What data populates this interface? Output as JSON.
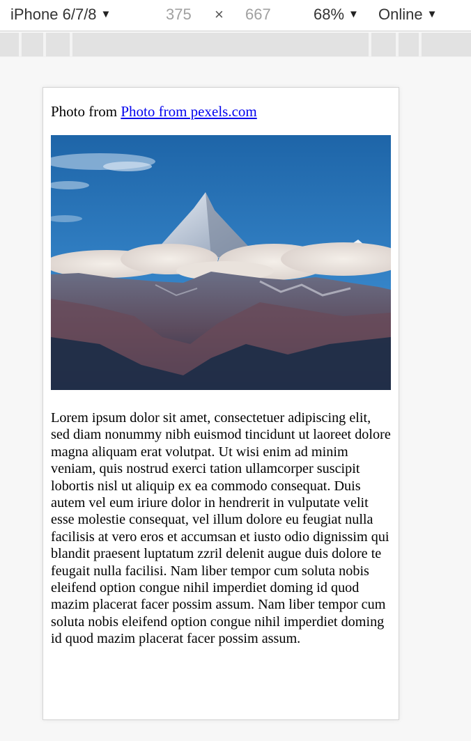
{
  "devtools": {
    "device": "iPhone 6/7/8",
    "width": "375",
    "times": "×",
    "height": "667",
    "zoom": "68%",
    "network": "Online"
  },
  "page": {
    "credit_prefix": "Photo from",
    "credit_link": "Photo from pexels.com",
    "paragraph": "Lorem ipsum dolor sit amet, consectetuer adipiscing elit, sed diam nonummy nibh euismod tincidunt ut laoreet dolore magna aliquam erat volutpat. Ut wisi enim ad minim veniam, quis nostrud exerci tation ullamcorper suscipit lobortis nisl ut aliquip ex ea commodo consequat. Duis autem vel eum iriure dolor in hendrerit in vulputate velit esse molestie consequat, vel illum dolore eu feugiat nulla facilisis at vero eros et accumsan et iusto odio dignissim qui blandit praesent luptatum zzril delenit augue duis dolore te feugait nulla facilisi. Nam liber tempor cum soluta nobis eleifend option congue nihil imperdiet doming id quod mazim placerat facer possim assum. Nam liber tempor cum soluta nobis eleifend option congue nihil imperdiet doming id quod mazim placerat facer possim assum."
  },
  "icons": {
    "dropdown": "caret-down-icon"
  },
  "colors": {
    "link": "#0000ee",
    "sky": "#2a6fb0",
    "page_background": "#f7f7f7"
  }
}
